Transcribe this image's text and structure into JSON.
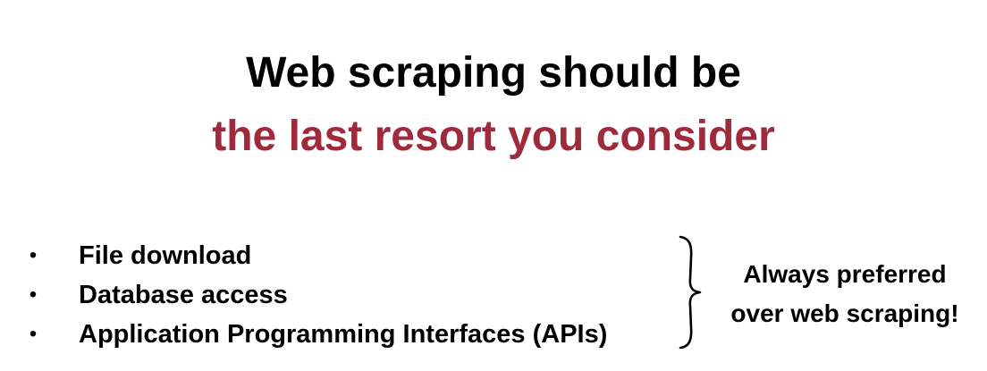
{
  "slide": {
    "title_line_1": "Web scraping should be",
    "title_line_2": "the last resort you consider",
    "accent_color": "#9e2a3c"
  },
  "bullets": [
    {
      "marker": "•",
      "text": "File download"
    },
    {
      "marker": "•",
      "text": "Database access"
    },
    {
      "marker": "•",
      "text": "Application Programming Interfaces (APIs)"
    }
  ],
  "note": {
    "line_1": "Always preferred",
    "line_2": "over web scraping!"
  },
  "icons": {
    "brace": "right-curly-brace-icon"
  }
}
